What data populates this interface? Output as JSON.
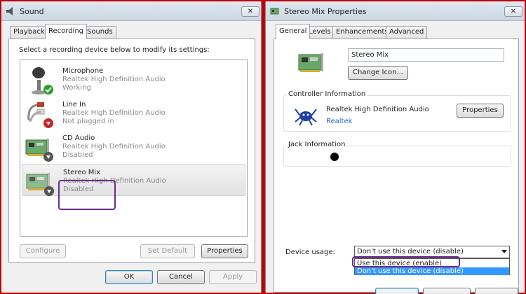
{
  "sound": {
    "title": "Sound",
    "close": "✕",
    "tabs": [
      "Playback",
      "Recording",
      "Sounds"
    ],
    "instruction": "Select a recording device below to modify its settings:",
    "devices": [
      {
        "name": "Microphone",
        "driver": "Realtek High Definition Audio",
        "status": "Working",
        "icon": "microphone-icon",
        "badge": "check-badge-icon"
      },
      {
        "name": "Line In",
        "driver": "Realtek High Definition Audio",
        "status": "Not plugged in",
        "icon": "line-in-cable-icon",
        "badge": "unplugged-badge-icon"
      },
      {
        "name": "CD Audio",
        "driver": "Realtek High Definition Audio",
        "status": "Disabled",
        "icon": "sound-card-icon",
        "badge": "disabled-badge-icon"
      },
      {
        "name": "Stereo Mix",
        "driver": "Realtek High Definition Audio",
        "status": "Disabled",
        "icon": "sound-card-icon",
        "badge": "disabled-badge-icon"
      }
    ],
    "buttons": {
      "configure": "Configure",
      "set_default": "Set Default",
      "properties": "Properties",
      "ok": "OK",
      "cancel": "Cancel",
      "apply": "Apply"
    }
  },
  "props": {
    "title": "Stereo Mix Properties",
    "tabs": [
      "General",
      "Levels",
      "Enhancements",
      "Advanced"
    ],
    "device_name": "Stereo Mix",
    "change_icon": "Change Icon...",
    "controller_title": "Controller Information",
    "controller_name": "Realtek High Definition Audio",
    "controller_link": "Realtek",
    "controller_properties": "Properties",
    "jack_title": "Jack Information",
    "device_usage_label": "Device usage:",
    "device_usage_value": "Don't use this device (disable)",
    "usage_options": [
      "Use this device (enable)",
      "Don't use this device (disable)"
    ],
    "usage_selected_index": 1
  },
  "colors": {
    "annotation": "#6b2a8a",
    "background_frame": "#c00000",
    "dropdown_highlight": "#3399ff",
    "link": "#1a66c8"
  }
}
